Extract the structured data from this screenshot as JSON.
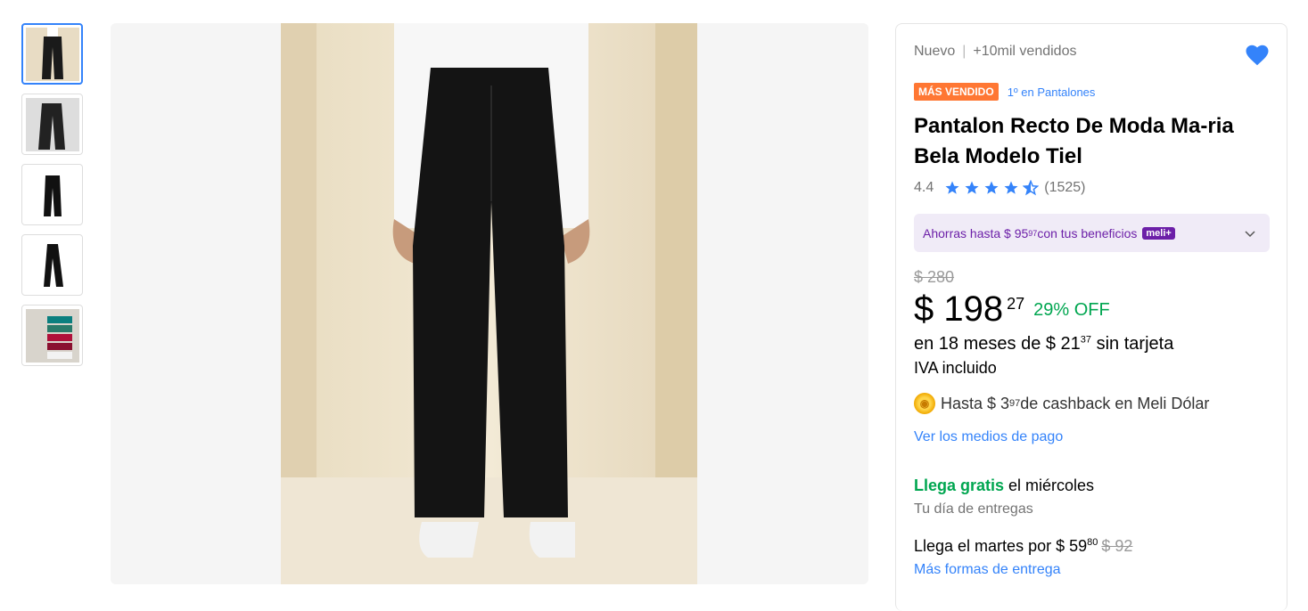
{
  "thumbnails": [
    {
      "alt": "Vista frontal pantalón negro"
    },
    {
      "alt": "Vista lateral pantalón negro"
    },
    {
      "alt": "Pantalón negro detalle"
    },
    {
      "alt": "Pantalón negro lateral"
    },
    {
      "alt": "Colores disponibles"
    }
  ],
  "product": {
    "condition": "Nuevo",
    "separator": "|",
    "sold": "+10mil vendidos",
    "badge": "MÁS VENDIDO",
    "rank": "1º en Pantalones",
    "title": "Pantalon Recto De Moda Ma-ria Bela Modelo Tiel",
    "rating": "4.4",
    "reviews": "(1525)",
    "stars": 4.4
  },
  "benefits": {
    "text_pre": "Ahorras hasta $ 95",
    "text_cents": "97",
    "text_post": " con tus beneficios",
    "meli_badge": "meli+"
  },
  "pricing": {
    "old_price": "$ 280",
    "price": "$ 198",
    "price_cents": "27",
    "discount": "29% OFF",
    "installments_pre": "en 18 meses de $ 21",
    "installments_cents": "37",
    "installments_post": " sin tarjeta",
    "tax": "IVA incluido",
    "cashback_pre": "Hasta $ 3",
    "cashback_cents": "97",
    "cashback_post": " de cashback en Meli Dólar",
    "payment_link": "Ver los medios de pago"
  },
  "shipping": {
    "free_label": "Llega gratis",
    "free_day": " el miércoles",
    "delivery_day_note": "Tu día de entregas",
    "alt_pre": "Llega el martes por $ 59",
    "alt_cents": "80",
    "alt_strike": "$ 92",
    "more_link": "Más formas de entrega"
  },
  "colors": {
    "accent": "#3483fa",
    "green": "#00a650",
    "badge": "#ff7733",
    "meli": "#6c1fa8"
  }
}
